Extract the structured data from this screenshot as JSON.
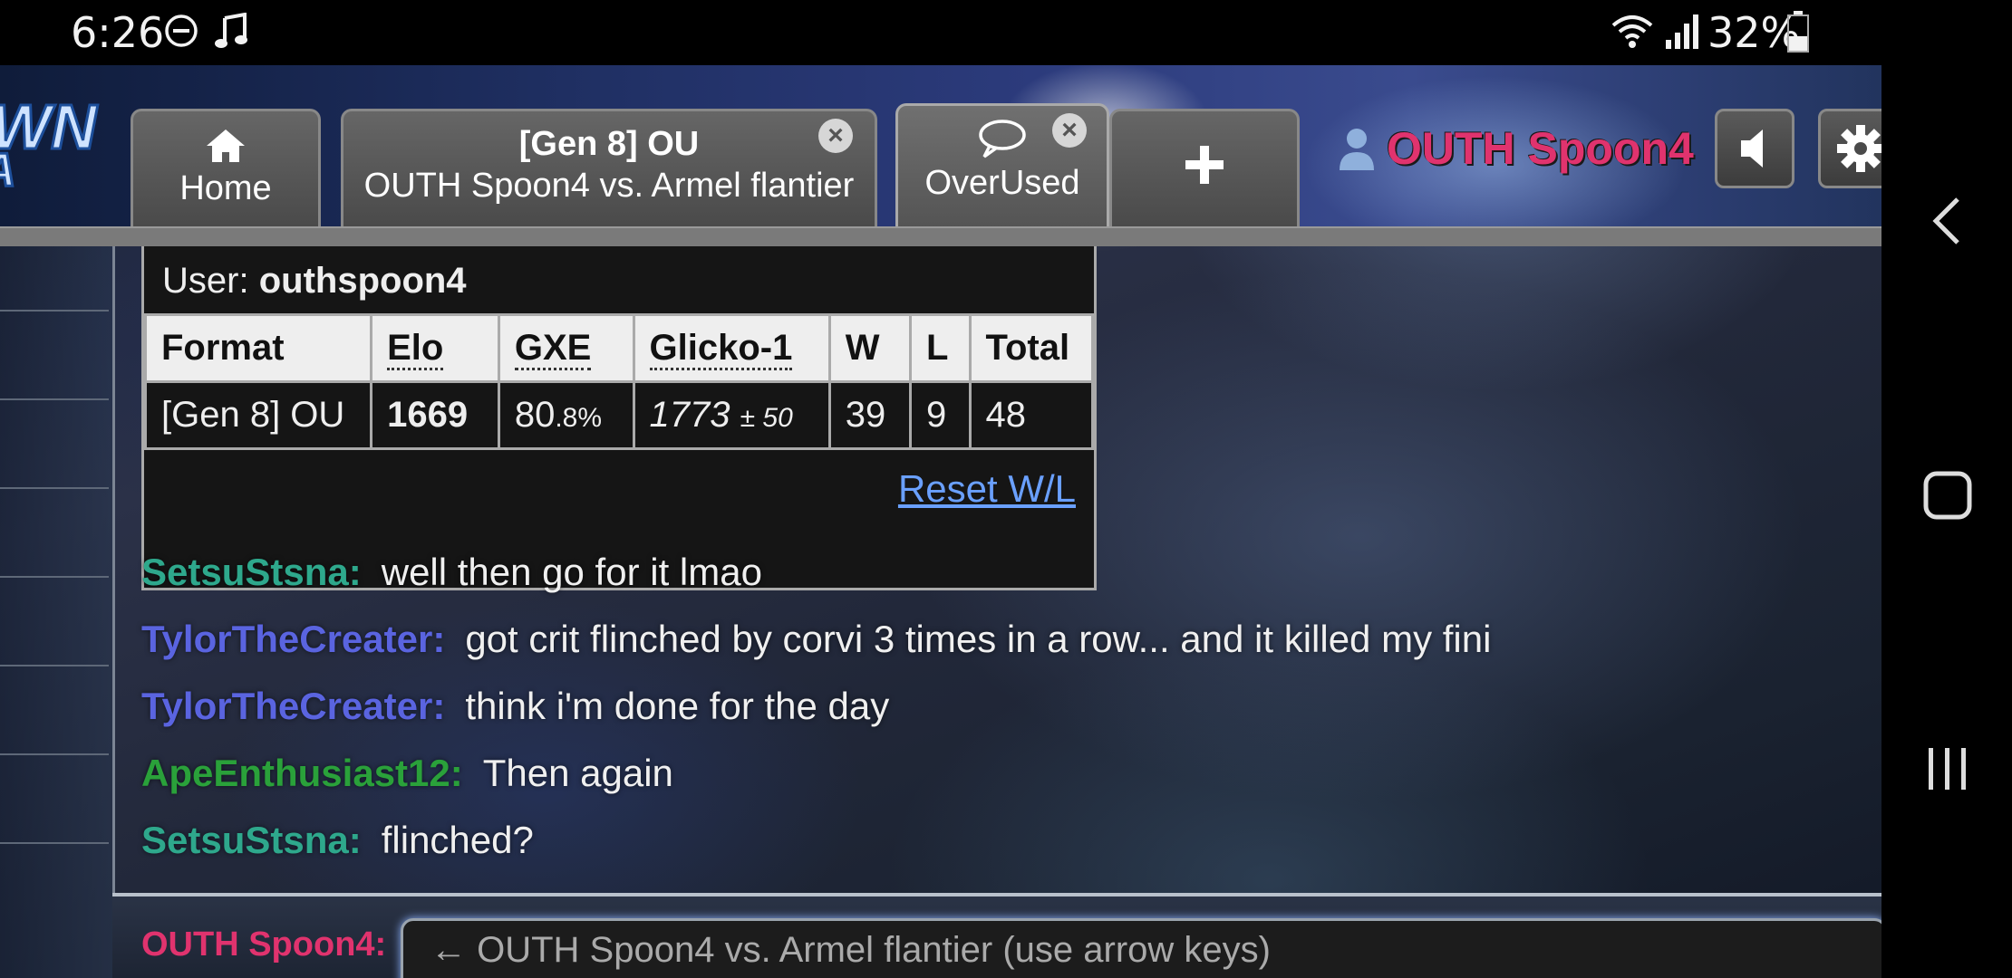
{
  "status_bar": {
    "time": "6:26",
    "battery": "32%"
  },
  "tabs": [
    {
      "icon": "home-icon",
      "label": "Home"
    },
    {
      "title": "[Gen 8] OU",
      "subtitle": "OUTH Spoon4 vs. Armel flantier"
    },
    {
      "icon": "chat-bubble-icon",
      "label": "OverUsed"
    },
    {
      "icon": "plus-icon",
      "label": "+"
    }
  ],
  "header": {
    "username": "OUTH Spoon4"
  },
  "ladder": {
    "user_label": "User:",
    "user_name": "outhspoon4",
    "columns": [
      "Format",
      "Elo",
      "GXE",
      "Glicko-1",
      "W",
      "L",
      "Total"
    ],
    "row": {
      "format": "[Gen 8] OU",
      "elo": "1669",
      "gxe_main": "80",
      "gxe_small": ".8%",
      "glicko_main": "1773",
      "glicko_small": "± 50",
      "w": "39",
      "l": "9",
      "total": "48"
    },
    "reset_link": "Reset W/L"
  },
  "chat": [
    {
      "user": "SetsuStsna:",
      "color": "#2ea88c",
      "message": "well then go for it lmao"
    },
    {
      "user": "TylorTheCreater:",
      "color": "#5a64e0",
      "message": "got crit flinched by corvi 3 times in a row... and it killed my fini"
    },
    {
      "user": "TylorTheCreater:",
      "color": "#5a64e0",
      "message": "think i'm done for the day"
    },
    {
      "user": "ApeEnthusiast12:",
      "color": "#2aa13a",
      "message": "Then again"
    },
    {
      "user": "SetsuStsna:",
      "color": "#2ea88c",
      "message": "flinched?"
    }
  ],
  "composer": {
    "user": "OUTH Spoon4:",
    "placeholder": "← OUTH Spoon4 vs. Armel flantier (use arrow keys)"
  },
  "colors": {
    "username": "#e0336e",
    "link": "#6aa0ff"
  }
}
